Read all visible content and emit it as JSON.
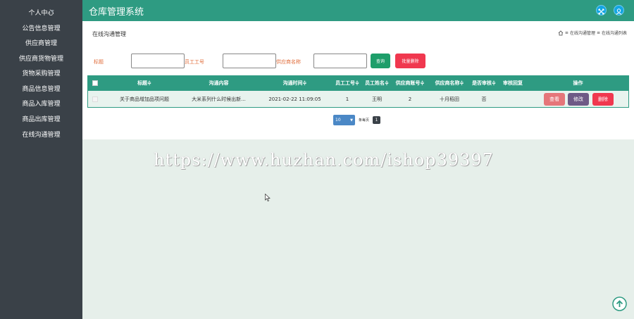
{
  "sidebar": {
    "items": [
      {
        "label": "个人中心"
      },
      {
        "label": "公告信息管理"
      },
      {
        "label": "供应商管理"
      },
      {
        "label": "供应商货物管理"
      },
      {
        "label": "货物采购管理"
      },
      {
        "label": "商品信息管理"
      },
      {
        "label": "商品入库管理"
      },
      {
        "label": "商品出库管理"
      },
      {
        "label": "在线沟通管理"
      }
    ]
  },
  "header": {
    "title": "仓库管理系统",
    "icons": [
      "expand-icon",
      "user-icon"
    ]
  },
  "page": {
    "title": "在线沟通管理",
    "breadcrumb": [
      "在线沟通管理",
      "在线沟通列表"
    ],
    "breadcrumb_sep": "≡"
  },
  "filters": {
    "title_label": "标题",
    "staff_no_label": "员工工号",
    "supplier_name_label": "供应商名称",
    "search_button": "查询",
    "batch_delete_button": "批量删除"
  },
  "table": {
    "headers": [
      "标题",
      "沟通内容",
      "沟通时间",
      "员工工号",
      "员工姓名",
      "供应商账号",
      "供应商名称",
      "是否审核",
      "审核回复",
      "操作"
    ],
    "sort_marker": "≑",
    "rows": [
      {
        "title": "关于商品增加品项问题",
        "content": "大米系列什么时候出新...",
        "time": "2021-02-22 11:09:05",
        "staff_no": "1",
        "staff_name": "王明",
        "supplier_account": "2",
        "supplier_name": "十月稻田",
        "audited": "否",
        "reply": "",
        "actions": {
          "view": "查看",
          "edit": "修改",
          "delete": "删除"
        }
      }
    ]
  },
  "pagination": {
    "page_size": "10",
    "per_page_text": "条每页",
    "current_page": "1"
  },
  "watermark": "https://www.huzhan.com/ishop39397",
  "colors": {
    "primary": "#2e9b82",
    "sidebar_bg": "#3a4148",
    "search_btn": "#1e9e6a",
    "danger": "#f0384f",
    "view_btn": "#e5767a",
    "edit_btn": "#6e5a86",
    "header_icon": "#13a6e3"
  }
}
